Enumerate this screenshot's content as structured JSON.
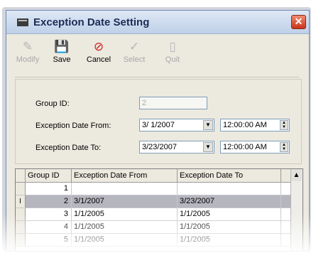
{
  "window": {
    "title": "Exception Date Setting"
  },
  "toolbar": {
    "modify": "Modify",
    "save": "Save",
    "cancel": "Cancel",
    "select": "Select",
    "quit": "Quit"
  },
  "form": {
    "group_id_label": "Group ID:",
    "group_id_value": "2",
    "from_label": "Exception Date From:",
    "from_date": "3/ 1/2007",
    "from_time": "12:00:00 AM",
    "to_label": "Exception Date To:",
    "to_date": "3/23/2007",
    "to_time": "12:00:00 AM"
  },
  "grid": {
    "headers": [
      "Group ID",
      "Exception Date From",
      "Exception Date To"
    ],
    "rows": [
      {
        "marker": "",
        "group": "1",
        "from": "",
        "to": ""
      },
      {
        "marker": "I",
        "group": "2",
        "from": "3/1/2007",
        "to": "3/23/2007"
      },
      {
        "marker": "",
        "group": "3",
        "from": "1/1/2005",
        "to": "1/1/2005"
      },
      {
        "marker": "",
        "group": "4",
        "from": "1/1/2005",
        "to": "1/1/2005"
      },
      {
        "marker": "",
        "group": "5",
        "from": "1/1/2005",
        "to": "1/1/2005"
      }
    ]
  }
}
